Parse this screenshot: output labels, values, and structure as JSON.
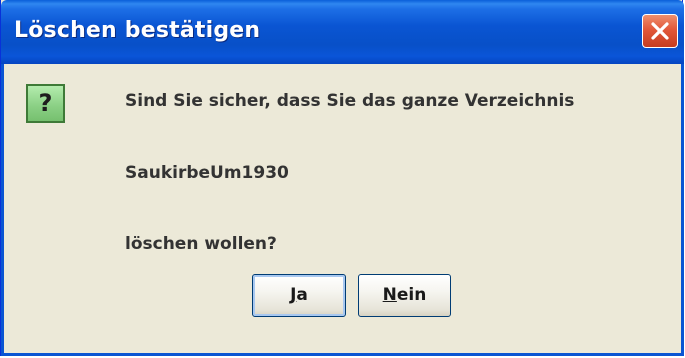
{
  "dialog": {
    "title": "Löschen bestätigen",
    "message_line1": "Sind Sie sicher, dass Sie das ganze Verzeichnis",
    "message_line2": "SaukirbeUm1930",
    "message_line3": "löschen wollen?",
    "icon_glyph": "?",
    "icon": "question-icon",
    "close_icon": "close-icon"
  },
  "buttons": {
    "yes_mnemonic": "J",
    "yes_rest": "a",
    "no_mnemonic": "N",
    "no_rest": "ein"
  },
  "colors": {
    "titlebar": "#0a55d3",
    "close_button": "#e2583a",
    "dialog_background": "#ece9d8",
    "icon_background": "#8cd186"
  }
}
